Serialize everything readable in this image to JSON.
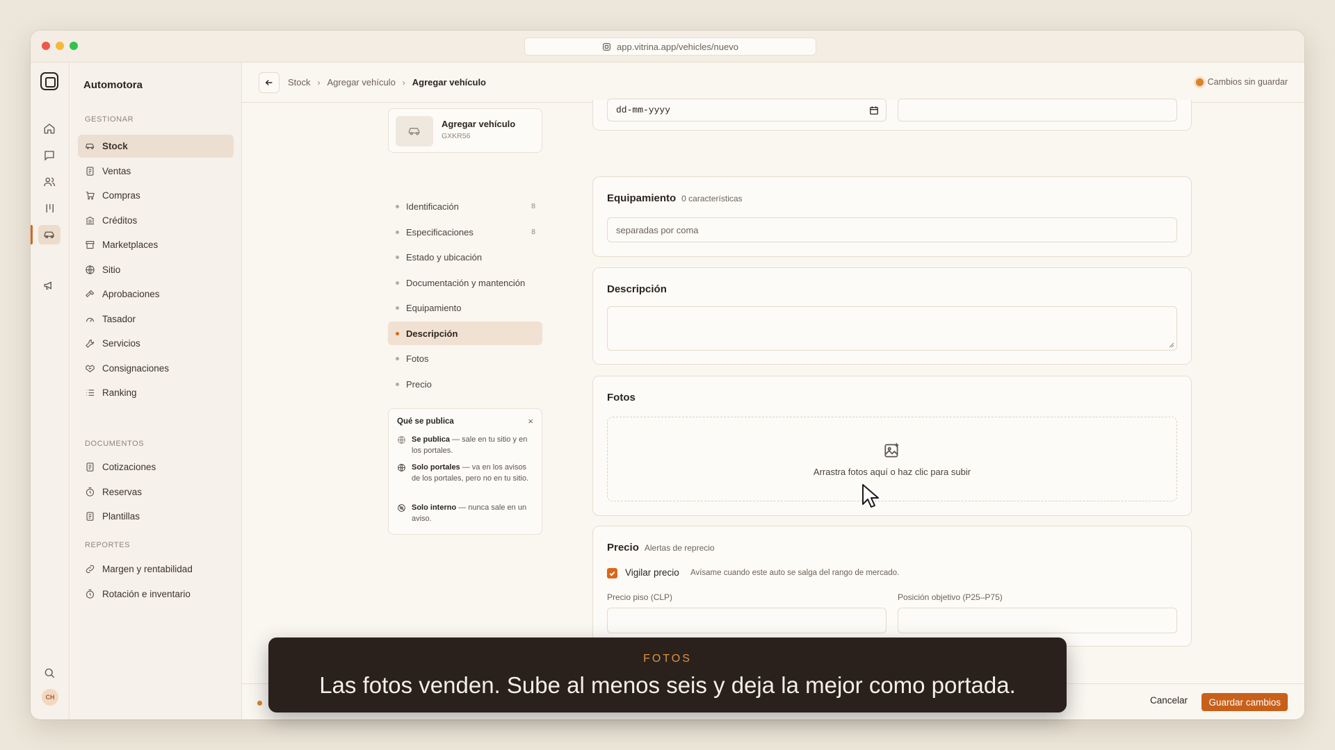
{
  "browser": {
    "url": "app.vitrina.app/vehicles/nuevo"
  },
  "sidebar": {
    "brand": "Automotora",
    "sections": [
      {
        "title": "GESTIONAR",
        "items": [
          "Stock",
          "Ventas",
          "Compras",
          "Créditos",
          "Marketplaces",
          "Sitio",
          "Aprobaciones",
          "Tasador",
          "Servicios",
          "Consignaciones",
          "Ranking"
        ]
      },
      {
        "title": "DOCUMENTOS",
        "items": [
          "Cotizaciones",
          "Reservas",
          "Plantillas"
        ]
      },
      {
        "title": "REPORTES",
        "items": [
          "Margen y rentabilidad",
          "Rotación e inventario"
        ]
      }
    ],
    "avatar": "CH"
  },
  "header": {
    "breadcrumbs": [
      "Stock",
      "Agregar vehículo",
      "Agregar vehículo"
    ],
    "status": "Cambios sin guardar"
  },
  "vehicle": {
    "title": "Agregar vehículo",
    "plate": "GXKR56"
  },
  "steps": [
    {
      "label": "Identificación",
      "count": "8"
    },
    {
      "label": "Especificaciones",
      "count": "8"
    },
    {
      "label": "Estado y ubicación",
      "count": ""
    },
    {
      "label": "Documentación y mantención",
      "count": ""
    },
    {
      "label": "Equipamiento",
      "count": ""
    },
    {
      "label": "Descripción",
      "count": ""
    },
    {
      "label": "Fotos",
      "count": ""
    },
    {
      "label": "Precio",
      "count": ""
    }
  ],
  "publish_info": {
    "title": "Qué se publica",
    "close": "×",
    "items": [
      {
        "bold": "Se publica",
        "text": " — sale en tu sitio y en los portales."
      },
      {
        "bold": "Solo portales",
        "text": " — va en los avisos de los portales, pero no en tu sitio."
      },
      {
        "bold": "Solo interno",
        "text": " — nunca sale en un aviso."
      }
    ]
  },
  "form": {
    "date_placeholder": "dd-mm-yyyy",
    "equipamiento": {
      "title": "Equipamiento",
      "subtitle": "0 características",
      "placeholder": "separadas por coma"
    },
    "descripcion": {
      "title": "Descripción"
    },
    "fotos": {
      "title": "Fotos",
      "drop_text": "Arrastra fotos aquí o haz clic para subir"
    },
    "precio": {
      "title": "Precio",
      "subtitle": "Alertas de reprecio",
      "watch_label": "Vigilar precio",
      "watch_hint": "Avísame cuando este auto se salga del rango de mercado.",
      "watch_checked": true,
      "floor_label": "Precio piso (CLP)",
      "target_label": "Posición objetivo (P25–P75)"
    }
  },
  "footer": {
    "cancel": "Cancelar",
    "save": "Guardar cambios"
  },
  "caption": {
    "kicker": "FOTOS",
    "message": "Las fotos venden. Sube al menos seis y deja la mejor como portada."
  },
  "colors": {
    "accent": "#d9681a",
    "background": "#faf6f0",
    "caption_bg": "#2a211c"
  }
}
